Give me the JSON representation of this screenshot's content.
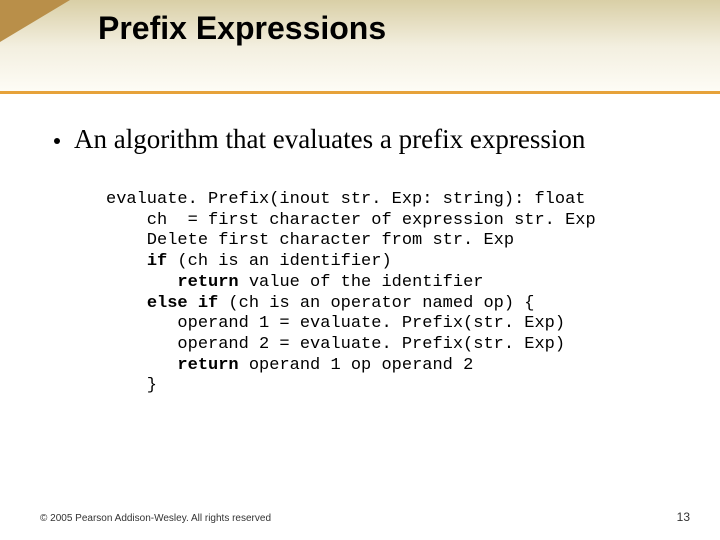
{
  "title": "Prefix Expressions",
  "bullet": "An algorithm that evaluates a prefix expression",
  "code_html": "evaluate. Prefix(inout str. Exp: string): float\n    ch  = first character of expression str. Exp\n    Delete first character from str. Exp\n    <b>if</b> (ch is an identifier)\n       <b>return</b> value of the identifier\n    <b>else if</b> (ch is an operator named op) {\n       operand 1 = evaluate. Prefix(str. Exp)\n       operand 2 = evaluate. Prefix(str. Exp)\n       <b>return</b> operand 1 op operand 2\n    }",
  "footer": {
    "copyright": "© 2005 Pearson Addison-Wesley. All rights reserved",
    "page": "13"
  }
}
